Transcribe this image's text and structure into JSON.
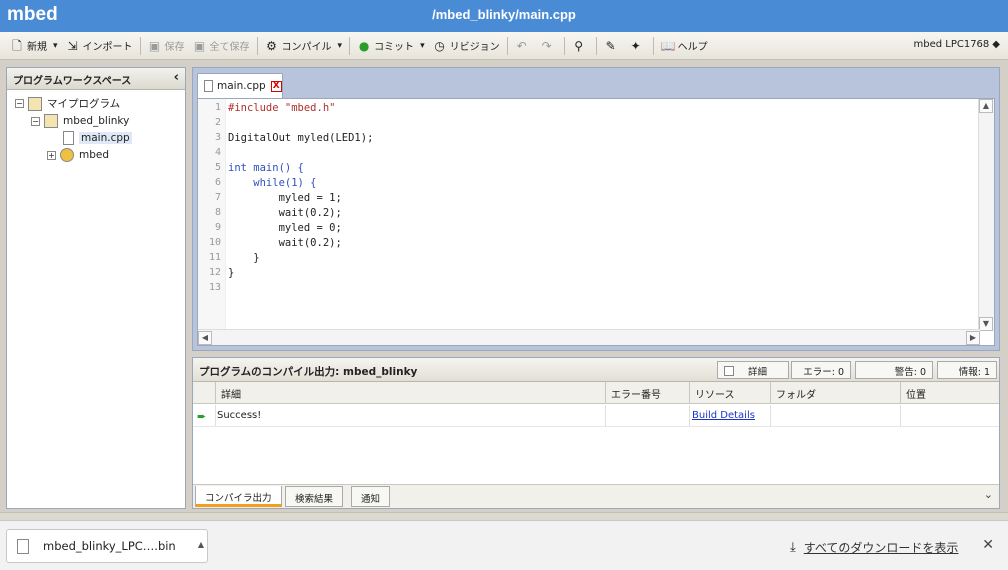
{
  "app": {
    "brand": "mbed",
    "path": "/mbed_blinky/main.cpp"
  },
  "toolbar": {
    "items": [
      {
        "label": "新規",
        "icon": "new-file-icon",
        "dropdown": true,
        "disabled": false
      },
      {
        "label": "インポート",
        "icon": "import-icon",
        "dropdown": false,
        "disabled": false
      },
      {
        "label": "保存",
        "icon": "save-icon",
        "dropdown": false,
        "disabled": true
      },
      {
        "label": "全て保存",
        "icon": "save-all-icon",
        "dropdown": false,
        "disabled": true
      },
      {
        "label": "コンパイル",
        "icon": "compile-icon",
        "dropdown": true,
        "disabled": false
      },
      {
        "label": "コミット",
        "icon": "commit-icon",
        "dropdown": true,
        "disabled": false
      },
      {
        "label": "リビジョン",
        "icon": "revision-icon",
        "dropdown": false,
        "disabled": false
      },
      {
        "label": "ヘルプ",
        "icon": "help-book-icon",
        "dropdown": false,
        "disabled": false
      }
    ],
    "device": "mbed LPC1768"
  },
  "sidebar": {
    "title": "プログラムワークスペース",
    "tree": [
      {
        "label": "マイプログラム",
        "icon": "workspace-icon"
      },
      {
        "label": "mbed_blinky",
        "icon": "program-icon"
      },
      {
        "label": "main.cpp",
        "icon": "cpp-file-icon"
      },
      {
        "label": "mbed",
        "icon": "library-gear-icon"
      }
    ]
  },
  "editor": {
    "tab_label": "main.cpp",
    "close_label": "X",
    "lines": [
      {
        "no": "1",
        "text": "#include \"mbed.h\"",
        "cls": "pre"
      },
      {
        "no": "2",
        "text": "",
        "cls": ""
      },
      {
        "no": "3",
        "text": "DigitalOut myled(LED1);",
        "cls": ""
      },
      {
        "no": "4",
        "text": "",
        "cls": ""
      },
      {
        "no": "5",
        "text": "int main() {",
        "cls": "kw"
      },
      {
        "no": "6",
        "text": "    while(1) {",
        "cls": "kw"
      },
      {
        "no": "7",
        "text": "        myled = 1;",
        "cls": ""
      },
      {
        "no": "8",
        "text": "        wait(0.2);",
        "cls": ""
      },
      {
        "no": "9",
        "text": "        myled = 0;",
        "cls": ""
      },
      {
        "no": "10",
        "text": "        wait(0.2);",
        "cls": ""
      },
      {
        "no": "11",
        "text": "    }",
        "cls": ""
      },
      {
        "no": "12",
        "text": "}",
        "cls": ""
      },
      {
        "no": "13",
        "text": "",
        "cls": ""
      }
    ]
  },
  "output": {
    "title": "プログラムのコンパイル出力: mbed_blinky",
    "detail_toggle": "詳細",
    "errors": "エラー: 0",
    "warnings": "警告: 0",
    "info": "情報: 1",
    "columns": [
      "詳細",
      "エラー番号",
      "リソース",
      "フォルダ",
      "位置"
    ],
    "row": {
      "detail": "Success!",
      "resource_link": "Build Details"
    },
    "tabs": [
      "コンパイラ出力",
      "検索結果",
      "通知"
    ]
  },
  "download": {
    "filename": "mbed_blinky_LPC….bin",
    "show_all": "すべてのダウンロードを表示"
  }
}
